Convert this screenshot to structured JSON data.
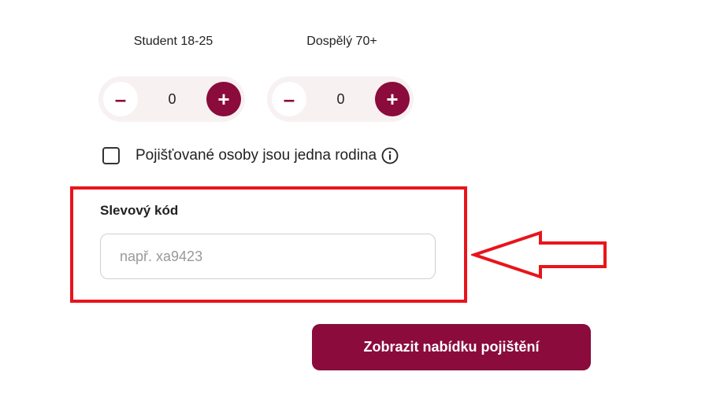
{
  "travelers": [
    {
      "label": "Student 18-25",
      "value": "0",
      "minus": "–",
      "plus": "+"
    },
    {
      "label": "Dospělý 70+",
      "value": "0",
      "minus": "–",
      "plus": "+"
    }
  ],
  "family": {
    "label": "Pojišťované osoby jsou jedna rodina",
    "checked": false,
    "info_icon": "info-circle-icon"
  },
  "discount": {
    "label": "Slevový kód",
    "placeholder": "např. xa9423",
    "value": ""
  },
  "submit": {
    "label": "Zobrazit nabídku pojištění"
  },
  "colors": {
    "brand": "#8a0b3c",
    "highlight": "#e8141c",
    "stepper_bg": "#f7f1f1"
  }
}
